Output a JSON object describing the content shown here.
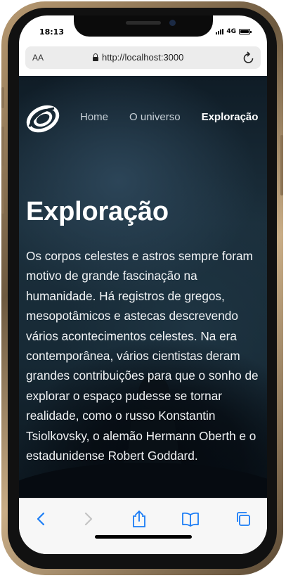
{
  "status_bar": {
    "time": "18:13",
    "network": "4G"
  },
  "browser": {
    "text_size_label": "AA",
    "url": "http://localhost:3000"
  },
  "site": {
    "nav": {
      "links": [
        {
          "label": "Home",
          "active": false
        },
        {
          "label": "O universo",
          "active": false
        },
        {
          "label": "Exploração",
          "active": true
        }
      ]
    },
    "page_title": "Exploração",
    "paragraph": "Os corpos celestes e astros sempre foram motivo de grande fascinação na humanidade. Há registros de gregos, mesopotâmicos e astecas descrevendo vários acontecimentos celestes. Na era contemporânea, vários cientistas deram grandes contribuições para que o sonho de explorar o espaço pudesse se tornar realidade, como o russo Konstantin Tsiolkovsky, o alemão Hermann Oberth e o estadunidense Robert Goddard."
  },
  "toolbar": {
    "items": [
      "back-icon",
      "forward-icon",
      "share-icon",
      "bookmarks-icon",
      "tabs-icon"
    ]
  },
  "colors": {
    "ios_blue": "#1a7cf5",
    "hero_dark": "#14242f",
    "text_light": "#f2f4f6"
  }
}
